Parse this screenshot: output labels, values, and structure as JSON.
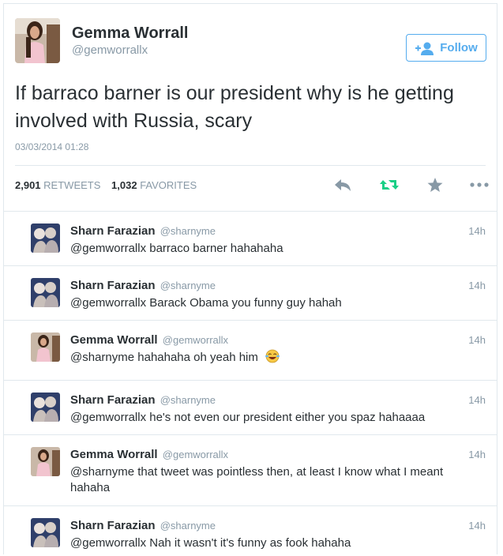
{
  "main_tweet": {
    "author_name": "Gemma Worrall",
    "author_handle": "@gemworrallx",
    "follow_label": "Follow",
    "text": "If barraco barner is our president why is he getting involved with Russia, scary",
    "timestamp": "03/03/2014 01:28",
    "retweets_count": "2,901",
    "retweets_label": "RETWEETS",
    "favorites_count": "1,032",
    "favorites_label": "FAVORITES",
    "icons": [
      "reply-icon",
      "retweet-icon",
      "favorite-icon",
      "more-icon"
    ],
    "colors": {
      "accent": "#55acee",
      "retweet": "#19cf86",
      "muted": "#8899a6"
    }
  },
  "replies": [
    {
      "name": "Sharn Farazian",
      "handle": "@sharnyme",
      "time": "14h",
      "text": "@gemworrallx barraco barner hahahaha"
    },
    {
      "name": "Sharn Farazian",
      "handle": "@sharnyme",
      "time": "14h",
      "text": "@gemworrallx Barack Obama you funny guy hahah"
    },
    {
      "name": "Gemma Worrall",
      "handle": "@gemworrallx",
      "time": "14h",
      "text": "@sharnyme hahahaha oh yeah him"
    },
    {
      "name": "Sharn Farazian",
      "handle": "@sharnyme",
      "time": "14h",
      "text": "@gemworrallx he's not even our president either you spaz hahaaaa"
    },
    {
      "name": "Gemma Worrall",
      "handle": "@gemworrallx",
      "time": "14h",
      "text": "@sharnyme that tweet was pointless then, at least I know what I meant hahaha"
    },
    {
      "name": "Sharn Farazian",
      "handle": "@sharnyme",
      "time": "14h",
      "text": "@gemworrallx Nah it wasn't it's funny as fook hahaha"
    }
  ]
}
